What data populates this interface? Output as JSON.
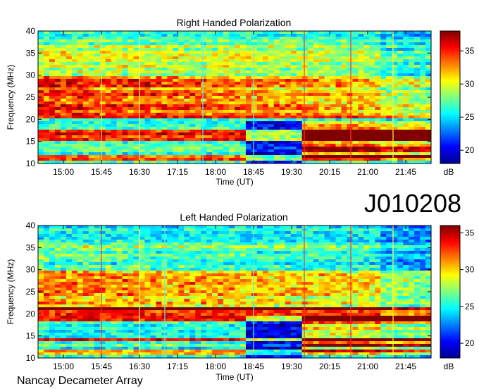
{
  "figure_id": "J010208",
  "footer": "Nancay Decameter Array",
  "chart_data": [
    {
      "type": "heatmap",
      "title": "Right Handed Polarization",
      "xlabel": "Time (UT)",
      "ylabel": "Frequency (MHz)",
      "xticks": [
        "15:00",
        "15:45",
        "16:30",
        "17:15",
        "18:00",
        "18:45",
        "19:30",
        "20:15",
        "21:00",
        "21:45"
      ],
      "yticks": [
        10,
        15,
        20,
        25,
        30,
        35,
        40
      ],
      "ylim": [
        10,
        40
      ],
      "colorbar": {
        "label": "dB",
        "ticks": [
          20,
          25,
          30,
          35
        ],
        "range": [
          18,
          38
        ],
        "colormap": "jet"
      },
      "vertical_markers": [
        {
          "time": "15:45",
          "color": "#e8e860"
        },
        {
          "time": "16:30",
          "color": "#ffff80"
        },
        {
          "time": "17:45",
          "color": "#5cf0f0"
        },
        {
          "time": "18:45",
          "color": "#5cf0f0"
        },
        {
          "time": "19:45",
          "color": "#ff3030"
        },
        {
          "time": "20:40",
          "color": "#ff3030"
        },
        {
          "time": "21:30",
          "color": "#ffff30"
        }
      ]
    },
    {
      "type": "heatmap",
      "title": "Left Handed Polarization",
      "xlabel": "Time (UT)",
      "ylabel": "Frequency (MHz)",
      "xticks": [
        "15:00",
        "15:45",
        "16:30",
        "17:15",
        "18:00",
        "18:45",
        "19:30",
        "20:15",
        "21:00",
        "21:45"
      ],
      "yticks": [
        10,
        15,
        20,
        25,
        30,
        35,
        40
      ],
      "ylim": [
        10,
        40
      ],
      "colorbar": {
        "label": "dB",
        "ticks": [
          20,
          25,
          30,
          35
        ],
        "range": [
          18,
          36
        ],
        "colormap": "jet"
      },
      "vertical_markers": [
        {
          "time": "15:45",
          "color": "#ff3030"
        },
        {
          "time": "16:30",
          "color": "#ffff80"
        },
        {
          "time": "17:00",
          "color": "#5cf0f0"
        },
        {
          "time": "18:45",
          "color": "#5cf0f0"
        },
        {
          "time": "19:45",
          "color": "#ff3030"
        },
        {
          "time": "20:40",
          "color": "#ff3030"
        },
        {
          "time": "21:30",
          "color": "#ffff30"
        }
      ]
    }
  ]
}
